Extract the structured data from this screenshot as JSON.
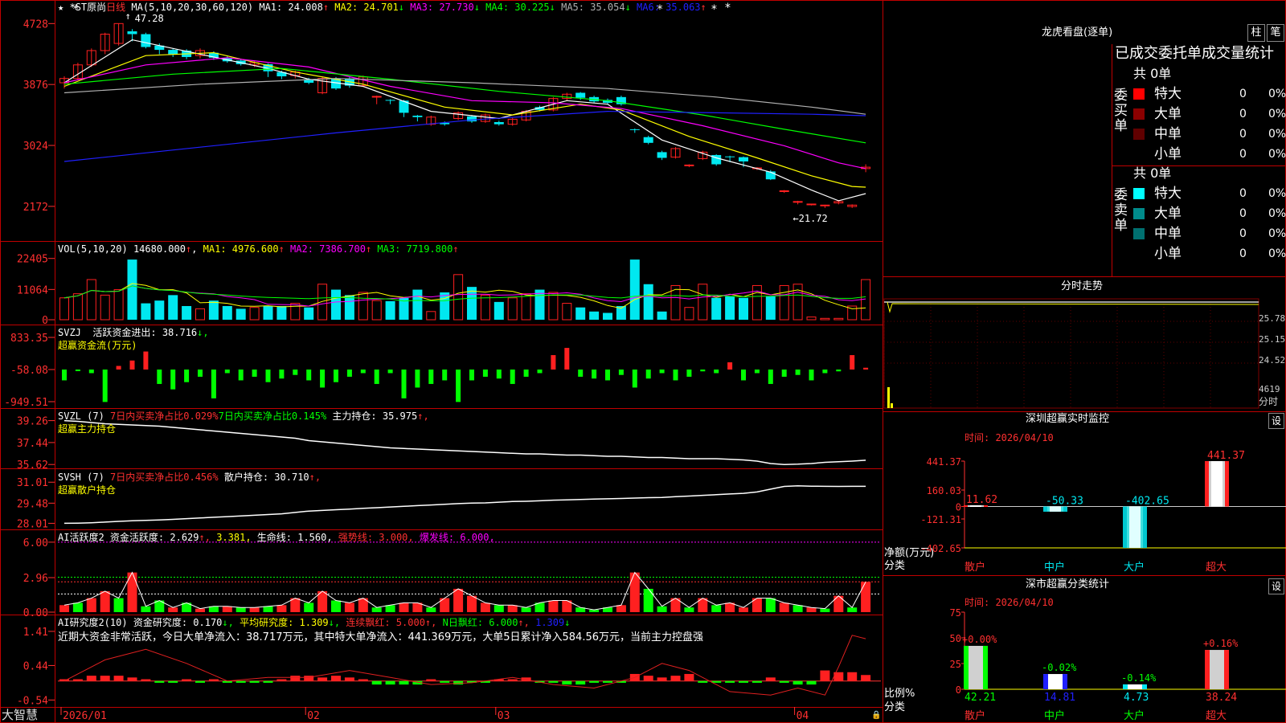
{
  "app": {
    "name": "大智慧"
  },
  "toolbar": {
    "rt_btn1": "柱",
    "rt_btn2": "笔"
  },
  "colors": {
    "bg": "#000000",
    "grid": "#c00000",
    "up": "#ff2020",
    "down": "#00e8f0",
    "white": "#ffffff",
    "yellow": "#ffff00",
    "magenta": "#ff00ff",
    "green": "#00ff00",
    "blue": "#2020ff",
    "gray": "#b0b0b0",
    "red": "#ff3030"
  },
  "icons": {
    "stars": "star-icon",
    "settings": "gear-icon",
    "lock": "lock-icon"
  },
  "kline": {
    "star": "★",
    "title": "*ST原尚",
    "period": "日线",
    "ma_label": "MA(5,10,20,30,60,120)",
    "ma": [
      {
        "name": "MA1",
        "value": "24.008",
        "arrow": "↑",
        "color": "#ffffff"
      },
      {
        "name": "MA2",
        "value": "24.701",
        "arrow": "↓",
        "color": "#ffff00"
      },
      {
        "name": "MA3",
        "value": "27.730",
        "arrow": "↓",
        "color": "#ff00ff"
      },
      {
        "name": "MA4",
        "value": "30.225",
        "arrow": "↓",
        "color": "#00ff00"
      },
      {
        "name": "MA5",
        "value": "35.054",
        "arrow": "↓",
        "color": "#b0b0b0"
      },
      {
        "name": "MA6",
        "value": "35.063",
        "arrow": "↑",
        "color": "#2020ff"
      }
    ],
    "yticks": [
      4728,
      3876,
      3024,
      2172
    ],
    "yrange": [
      1800,
      4900
    ],
    "high_label": "47.28",
    "low_label": "21.72",
    "x_labels": [
      "2026/01",
      "02",
      "03",
      "04"
    ],
    "x_label_idx": [
      0,
      18,
      32,
      54
    ],
    "candles": [
      [
        3900,
        3960,
        3820,
        3990
      ],
      [
        3960,
        4150,
        3940,
        4180
      ],
      [
        4150,
        4350,
        4120,
        4380
      ],
      [
        4350,
        4580,
        4300,
        4600
      ],
      [
        4450,
        4728,
        4420,
        4728
      ],
      [
        4620,
        4580,
        4480,
        4650
      ],
      [
        4580,
        4400,
        4380,
        4600
      ],
      [
        4420,
        4360,
        4300,
        4450
      ],
      [
        4360,
        4300,
        4260,
        4380
      ],
      [
        4350,
        4260,
        4230,
        4370
      ],
      [
        4280,
        4350,
        4240,
        4380
      ],
      [
        4320,
        4250,
        4220,
        4340
      ],
      [
        4250,
        4200,
        4180,
        4270
      ],
      [
        4210,
        4160,
        4140,
        4230
      ],
      [
        4150,
        4180,
        4120,
        4200
      ],
      [
        4160,
        4060,
        3980,
        4170
      ],
      [
        4050,
        3990,
        3950,
        4070
      ],
      [
        4000,
        4050,
        3960,
        4070
      ],
      [
        3950,
        3900,
        3880,
        3970
      ],
      [
        3760,
        3960,
        3740,
        3990
      ],
      [
        3960,
        3820,
        3800,
        3980
      ],
      [
        3960,
        3860,
        3830,
        3980
      ],
      [
        3860,
        3980,
        3840,
        4000
      ],
      [
        3700,
        3710,
        3600,
        3720
      ],
      [
        3660,
        3650,
        3600,
        3670
      ],
      [
        3650,
        3480,
        3420,
        3660
      ],
      [
        3440,
        3420,
        3360,
        3450
      ],
      [
        3320,
        3420,
        3300,
        3440
      ],
      [
        3340,
        3320,
        3300,
        3360
      ],
      [
        3400,
        3480,
        3380,
        3500
      ],
      [
        3430,
        3360,
        3340,
        3450
      ],
      [
        3360,
        3450,
        3340,
        3470
      ],
      [
        3350,
        3320,
        3300,
        3370
      ],
      [
        3320,
        3390,
        3300,
        3410
      ],
      [
        3380,
        3500,
        3360,
        3520
      ],
      [
        3560,
        3520,
        3500,
        3580
      ],
      [
        3520,
        3680,
        3500,
        3700
      ],
      [
        3680,
        3740,
        3650,
        3760
      ],
      [
        3760,
        3690,
        3660,
        3770
      ],
      [
        3700,
        3640,
        3620,
        3720
      ],
      [
        3660,
        3620,
        3600,
        3680
      ],
      [
        3700,
        3600,
        3580,
        3720
      ],
      [
        3250,
        3240,
        3200,
        3260
      ],
      [
        3140,
        3060,
        3040,
        3160
      ],
      [
        2930,
        2850,
        2820,
        2950
      ],
      [
        2860,
        2980,
        2840,
        3000
      ],
      [
        2740,
        2750,
        2720,
        2760
      ],
      [
        2840,
        2930,
        2820,
        2950
      ],
      [
        2890,
        2760,
        2740,
        2900
      ],
      [
        2870,
        2860,
        2790,
        2880
      ],
      [
        2860,
        2800,
        2720,
        2870
      ],
      [
        2700,
        2710,
        2680,
        2720
      ],
      [
        2660,
        2550,
        2540,
        2680
      ],
      [
        2380,
        2390,
        2360,
        2400
      ],
      [
        2230,
        2240,
        2200,
        2250
      ],
      [
        2200,
        2205,
        2185,
        2210
      ],
      [
        2180,
        2190,
        2150,
        2195
      ],
      [
        2220,
        2240,
        2200,
        2260
      ],
      [
        2170,
        2190,
        2150,
        2200
      ],
      [
        2700,
        2720,
        2650,
        2760
      ]
    ],
    "ma_curves": {
      "ma5": [
        [
          0,
          3900
        ],
        [
          5,
          4500
        ],
        [
          10,
          4300
        ],
        [
          15,
          4100
        ],
        [
          18,
          3950
        ],
        [
          22,
          3850
        ],
        [
          27,
          3500
        ],
        [
          32,
          3400
        ],
        [
          37,
          3650
        ],
        [
          40,
          3600
        ],
        [
          44,
          3100
        ],
        [
          48,
          2850
        ],
        [
          52,
          2650
        ],
        [
          55,
          2400
        ],
        [
          57,
          2250
        ],
        [
          59,
          2350
        ]
      ],
      "ma10": [
        [
          0,
          3850
        ],
        [
          6,
          4280
        ],
        [
          11,
          4320
        ],
        [
          17,
          4050
        ],
        [
          22,
          3880
        ],
        [
          28,
          3560
        ],
        [
          33,
          3450
        ],
        [
          38,
          3600
        ],
        [
          41,
          3520
        ],
        [
          46,
          3150
        ],
        [
          51,
          2850
        ],
        [
          55,
          2600
        ],
        [
          58,
          2450
        ],
        [
          59,
          2440
        ]
      ],
      "ma20": [
        [
          0,
          3900
        ],
        [
          6,
          4150
        ],
        [
          12,
          4250
        ],
        [
          18,
          4120
        ],
        [
          24,
          3850
        ],
        [
          30,
          3650
        ],
        [
          36,
          3620
        ],
        [
          41,
          3540
        ],
        [
          47,
          3300
        ],
        [
          53,
          3020
        ],
        [
          57,
          2780
        ],
        [
          59,
          2700
        ]
      ],
      "ma30": [
        [
          0,
          3880
        ],
        [
          8,
          4020
        ],
        [
          16,
          4100
        ],
        [
          24,
          3950
        ],
        [
          32,
          3780
        ],
        [
          40,
          3650
        ],
        [
          47,
          3450
        ],
        [
          53,
          3250
        ],
        [
          59,
          3060
        ]
      ],
      "ma60": [
        [
          0,
          3760
        ],
        [
          10,
          3880
        ],
        [
          20,
          3960
        ],
        [
          30,
          3900
        ],
        [
          40,
          3820
        ],
        [
          48,
          3700
        ],
        [
          55,
          3560
        ],
        [
          59,
          3460
        ]
      ],
      "ma120": [
        [
          0,
          2800
        ],
        [
          10,
          3000
        ],
        [
          20,
          3200
        ],
        [
          30,
          3380
        ],
        [
          40,
          3500
        ],
        [
          48,
          3480
        ],
        [
          55,
          3460
        ],
        [
          59,
          3440
        ]
      ]
    }
  },
  "vol": {
    "label": "VOL(5,10,20)",
    "value": "14680.000",
    "ma": [
      {
        "name": "MA1",
        "value": "4976.600",
        "arrow": "↑",
        "color": "#ffff00"
      },
      {
        "name": "MA2",
        "value": "7386.700",
        "arrow": "↑",
        "color": "#ff00ff"
      },
      {
        "name": "MA3",
        "value": "7719.800",
        "arrow": "↑",
        "color": "#00ff00"
      }
    ],
    "yticks": [
      "22405",
      "11064",
      "0"
    ],
    "ymax": 23500,
    "values": [
      8000,
      9500,
      14680,
      9000,
      11000,
      22000,
      6000,
      7000,
      9000,
      5000,
      4000,
      7000,
      5000,
      4000,
      4500,
      5000,
      5000,
      6000,
      4500,
      13000,
      11000,
      9000,
      10000,
      7000,
      6800,
      8000,
      11000,
      3000,
      10000,
      16500,
      12000,
      9000,
      6500,
      8000,
      9500,
      11000,
      10000,
      6000,
      4500,
      3000,
      2500,
      5000,
      22000,
      13000,
      3000,
      12500,
      4500,
      13000,
      8000,
      8500,
      8000,
      12500,
      8500,
      12500,
      13000,
      1000,
      500,
      500,
      5000,
      14680
    ]
  },
  "svzj": {
    "label": "SVZJ",
    "t1": "活跃资金进出: ",
    "v1": "38.716",
    "a1": "↓,",
    "t2": "超赢资金流(万元)",
    "yticks": [
      "833.35",
      "-58.08",
      "-949.51"
    ],
    "range": [
      -949.51,
      833.35
    ],
    "values": [
      -300,
      -20,
      -100,
      -900,
      100,
      250,
      500,
      -400,
      -550,
      -350,
      -200,
      -800,
      -100,
      -300,
      -200,
      -350,
      -250,
      -150,
      -300,
      -500,
      -350,
      -200,
      -100,
      -400,
      -100,
      -800,
      -500,
      -400,
      -300,
      -900,
      -300,
      -200,
      -250,
      -400,
      -200,
      -100,
      400,
      600,
      -200,
      -250,
      -300,
      -150,
      -500,
      -250,
      -100,
      -300,
      -200,
      -50,
      -100,
      200,
      -300,
      -100,
      -400,
      -200,
      -150,
      -300,
      -100,
      -50,
      400,
      50
    ]
  },
  "svzl": {
    "label": "SVZL (7)",
    "t1": "7日内买卖净占比0.029%",
    "t2": "7日内买卖净占比0.145%",
    "t3": "主力持仓: ",
    "v3": "35.975",
    "a3": "↑,",
    "t4": "超赢主力持仓",
    "yticks": [
      "39.26",
      "37.44",
      "35.62"
    ],
    "range": [
      35.5,
      39.5
    ],
    "values": [
      39.26,
      39.2,
      39.1,
      39.0,
      38.95,
      38.9,
      38.85,
      38.8,
      38.7,
      38.6,
      38.5,
      38.4,
      38.3,
      38.2,
      38.1,
      38.0,
      37.9,
      37.8,
      37.6,
      37.5,
      37.4,
      37.3,
      37.2,
      37.1,
      37.0,
      36.95,
      36.9,
      36.85,
      36.8,
      36.75,
      36.7,
      36.65,
      36.6,
      36.55,
      36.5,
      36.5,
      36.45,
      36.4,
      36.4,
      36.35,
      36.3,
      36.3,
      36.25,
      36.2,
      36.2,
      36.15,
      36.1,
      36.1,
      36.1,
      36.05,
      36.0,
      35.9,
      35.7,
      35.62,
      35.65,
      35.7,
      35.8,
      35.85,
      35.9,
      35.975
    ]
  },
  "svsh": {
    "label": "SVSH (7)",
    "t1": "7日内买卖净占比0.456%",
    "t2": "散户持仓: ",
    "v2": "30.710",
    "a2": "↑,",
    "t3": "超赢散户持仓",
    "yticks": [
      "31.01",
      "29.48",
      "28.01"
    ],
    "range": [
      27.8,
      31.2
    ],
    "values": [
      28.01,
      28.02,
      28.05,
      28.1,
      28.15,
      28.2,
      28.22,
      28.25,
      28.3,
      28.35,
      28.4,
      28.45,
      28.5,
      28.55,
      28.6,
      28.65,
      28.7,
      28.8,
      28.9,
      28.95,
      29.0,
      29.05,
      29.1,
      29.15,
      29.2,
      29.25,
      29.3,
      29.35,
      29.4,
      29.45,
      29.48,
      29.5,
      29.55,
      29.6,
      29.62,
      29.65,
      29.7,
      29.72,
      29.75,
      29.78,
      29.8,
      29.82,
      29.85,
      29.88,
      29.9,
      29.95,
      30.0,
      30.05,
      30.1,
      30.15,
      30.2,
      30.3,
      30.5,
      30.7,
      30.75,
      30.72,
      30.71,
      30.7,
      30.71,
      30.71
    ]
  },
  "ai1": {
    "label": "AI活跃度2",
    "t1": "资金活跃度: ",
    "v1": "2.629",
    "a1": "↑,",
    "v2": "3.381",
    "a2": ",",
    "t3": "生命线: ",
    "v3": "1.560",
    "a3": ",",
    "t4": "强势线: ",
    "v4": "3.000",
    "a4": ",",
    "t5": "爆发线: ",
    "v5": "6.000",
    "a5": ",",
    "yticks": [
      "6.00",
      "2.96",
      "0.00"
    ],
    "range": [
      0,
      6.2
    ],
    "bars": [
      0.6,
      0.8,
      1.2,
      1.8,
      1.2,
      3.4,
      0.5,
      1.0,
      0.4,
      0.8,
      0.3,
      0.5,
      0.5,
      0.4,
      0.4,
      0.5,
      0.6,
      1.2,
      0.8,
      1.8,
      1.0,
      0.8,
      1.2,
      0.4,
      0.6,
      0.8,
      0.8,
      0.4,
      1.2,
      2.0,
      1.4,
      0.8,
      0.6,
      0.6,
      0.4,
      0.8,
      1.0,
      1.0,
      0.4,
      0.2,
      0.4,
      0.6,
      3.4,
      2.0,
      0.5,
      1.2,
      0.4,
      1.2,
      0.6,
      0.8,
      0.4,
      1.2,
      1.2,
      0.8,
      0.6,
      0.4,
      0.3,
      1.4,
      0.4,
      2.6
    ],
    "colors": "rgrrgrggrgrgrgrgrrgrgrrggrrgrrrrgrggrrgggrrggrgrgrrrgrgrgrgr"
  },
  "ai2": {
    "label": "AI研究度2(10)",
    "t1": "资金研究度: ",
    "v1": "0.170",
    "a1": "↓,",
    "t2": "平均研究度: ",
    "v2": "1.309",
    "a2": "↓,",
    "t3": "连续飘红: ",
    "v3": "5.000",
    "a3": "↑,",
    "t4": "N日飘红: ",
    "v4": "6.000",
    "a4": "↑,",
    "v5": "1.309",
    "a5": "↓",
    "desc": "近期大资金非常活跃，今日大单净流入：38.717万元，其中特大单净流入：441.369万元，大单5日累计净入584.56万元，当前主力控盘强",
    "yticks": [
      "1.41",
      "0.44",
      "-0.54"
    ],
    "range": [
      -0.6,
      1.5
    ],
    "bars": [
      0.05,
      0.05,
      0.15,
      0.15,
      0.15,
      0.1,
      0.05,
      -0.05,
      -0.05,
      0.05,
      -0.05,
      0.05,
      -0.05,
      -0.05,
      -0.05,
      -0.05,
      0.05,
      0.15,
      0.15,
      0.1,
      0.15,
      0.1,
      0.05,
      -0.1,
      -0.1,
      -0.1,
      -0.1,
      0.05,
      -0.05,
      -0.1,
      -0.05,
      -0.05,
      0.05,
      0.05,
      0.1,
      -0.05,
      -0.05,
      -0.1,
      -0.1,
      -0.05,
      -0.05,
      -0.05,
      0.2,
      0.15,
      0.1,
      0.15,
      0.2,
      -0.05,
      -0.05,
      -0.05,
      -0.05,
      -0.05,
      0.1,
      -0.05,
      -0.1,
      -0.1,
      0.3,
      0.25,
      0.25,
      0.17
    ],
    "line": [
      [
        0,
        0.0
      ],
      [
        3,
        0.6
      ],
      [
        6,
        0.9
      ],
      [
        9,
        0.5
      ],
      [
        12,
        0.0
      ],
      [
        15,
        0.1
      ],
      [
        18,
        0.1
      ],
      [
        21,
        0.3
      ],
      [
        24,
        0.1
      ],
      [
        27,
        -0.1
      ],
      [
        30,
        -0.05
      ],
      [
        33,
        0.1
      ],
      [
        36,
        -0.1
      ],
      [
        39,
        -0.2
      ],
      [
        42,
        0.1
      ],
      [
        44,
        0.5
      ],
      [
        46,
        0.3
      ],
      [
        49,
        -0.3
      ],
      [
        52,
        -0.4
      ],
      [
        54,
        -0.2
      ],
      [
        56,
        -0.4
      ],
      [
        57,
        0.4
      ],
      [
        58,
        1.3
      ],
      [
        59,
        1.2
      ]
    ]
  },
  "right": {
    "lh_title": "龙虎看盘(逐单)",
    "lh_subtitle": "已成交委托单成交量统计",
    "buy_total": "共 0单",
    "buy_label": "委买单",
    "sell_total": "共 0单",
    "sell_label": "委卖单",
    "buy_rows": [
      {
        "name": "特大",
        "count": "0",
        "pct": "0%",
        "color": "#ff0000"
      },
      {
        "name": "大单",
        "count": "0",
        "pct": "0%",
        "color": "#8b0000"
      },
      {
        "name": "中单",
        "count": "0",
        "pct": "0%",
        "color": "#600000"
      },
      {
        "name": "小单",
        "count": "0",
        "pct": "0%",
        "color": ""
      }
    ],
    "sell_rows": [
      {
        "name": "特大",
        "count": "0",
        "pct": "0%",
        "color": "#00ffff"
      },
      {
        "name": "大单",
        "count": "0",
        "pct": "0%",
        "color": "#008b8b"
      },
      {
        "name": "中单",
        "count": "0",
        "pct": "0%",
        "color": "#007070"
      },
      {
        "name": "小单",
        "count": "0",
        "pct": "0%",
        "color": ""
      }
    ],
    "fs_title": "分时走势",
    "fs_ticks": [
      "25.78",
      "25.15",
      "24.52"
    ],
    "fs_vol": "4619",
    "fs_vol_label": "分时",
    "sz_title": "深圳超赢实时监控",
    "sz_btn": "设",
    "sz_time": "时间: 2026/04/10",
    "sz_yticks": [
      "441.37",
      "160.03",
      "0",
      "-121.31",
      "-402.65"
    ],
    "sz_range": [
      -402.65,
      441.37
    ],
    "sz_cats": [
      "散户",
      "中户",
      "大户",
      "超大"
    ],
    "sz_values": [
      11.62,
      -50.33,
      -402.65,
      441.37
    ],
    "sz_labels": [
      "11.62",
      "-50.33",
      "-402.65",
      "441.37"
    ],
    "sz_axis_label1": "净额(万元)",
    "sz_axis_label2": "分类",
    "ss_title": "深市超赢分类统计",
    "ss_btn": "设",
    "ss_time": "时间: 2026/04/10",
    "ss_yticks": [
      "75",
      "50",
      "25",
      "0"
    ],
    "ss_range": [
      0,
      75
    ],
    "ss_cats": [
      "散户",
      "中户",
      "大户",
      "超大"
    ],
    "ss_values": [
      42.21,
      14.81,
      4.73,
      38.24
    ],
    "ss_changes": [
      "+0.00%",
      "-0.02%",
      "-0.14%",
      "+0.16%"
    ],
    "ss_labels": [
      "42.21",
      "14.81",
      "4.73",
      "38.24"
    ],
    "ss_axis_label1": "比例%",
    "ss_axis_label2": "分类"
  }
}
